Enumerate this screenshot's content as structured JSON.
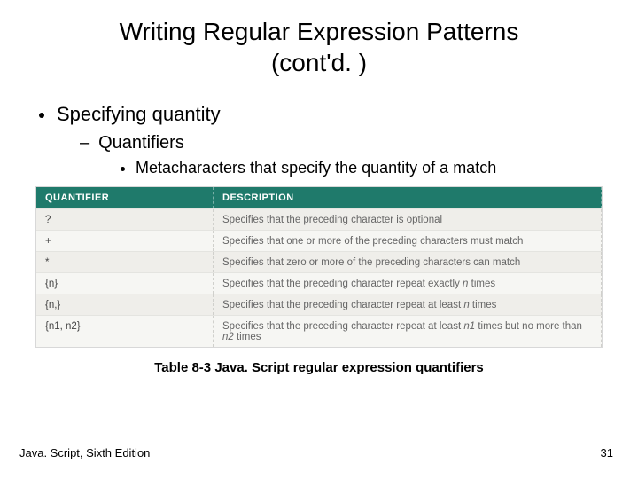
{
  "title": {
    "line1": "Writing Regular Expression Patterns",
    "line2": "(cont'd. )"
  },
  "bullets": {
    "l1": "Specifying quantity",
    "l2": "Quantifiers",
    "l3": "Metacharacters that specify the quantity of a match"
  },
  "table": {
    "headers": [
      "QUANTIFIER",
      "DESCRIPTION"
    ],
    "rows": [
      {
        "q": "?",
        "d": "Specifies that the preceding character is optional"
      },
      {
        "q": "+",
        "d": "Specifies that one or more of the preceding characters must match"
      },
      {
        "q": "*",
        "d": "Specifies that zero or more of the preceding characters can match"
      },
      {
        "q": "{n}",
        "d_pre": "Specifies that the preceding character repeat exactly ",
        "d_var": "n",
        "d_post": " times"
      },
      {
        "q": "{n,}",
        "d_pre": "Specifies that the preceding character repeat at least ",
        "d_var": "n",
        "d_post": " times"
      },
      {
        "q": "{n1, n2}",
        "d_pre": "Specifies that the preceding character repeat at least ",
        "d_var1": "n1",
        "d_mid": " times but no more than ",
        "d_var2": "n2",
        "d_post": " times"
      }
    ],
    "caption": "Table 8-3 Java. Script regular expression quantifiers"
  },
  "footer": {
    "left": "Java. Script, Sixth Edition",
    "page": "31"
  }
}
